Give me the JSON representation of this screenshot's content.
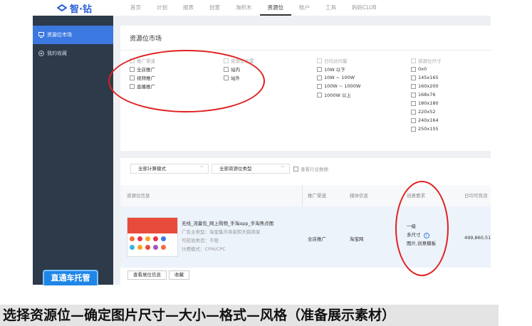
{
  "logo": {
    "text": "智·钻"
  },
  "nav": [
    "首页",
    "计划",
    "报表",
    "创意",
    "淘积木",
    "资源位",
    "账户",
    "工具",
    "妈妈CLUB"
  ],
  "nav_active": "资源位",
  "sidebar": {
    "items": [
      {
        "label": "资源位市场",
        "icon": "monitor-icon"
      },
      {
        "label": "我的收藏",
        "icon": "star-icon"
      }
    ],
    "banner": "直通车托管"
  },
  "market": {
    "title": "资源位市场",
    "col_channel": {
      "header": "推广渠道",
      "items": [
        "全店推广",
        "视频推广",
        "直播推广"
      ]
    },
    "col_position": {
      "header": "资源位位置",
      "items": [
        "站内",
        "站外"
      ]
    },
    "col_visits": {
      "header": "日均访问量",
      "items": [
        "10W 以下",
        "10W ~ 100W",
        "100W ~ 1000W",
        "1000W 以上"
      ]
    },
    "col_size": {
      "header": "资源位尺寸",
      "items": [
        "0x0",
        "145x165",
        "160x200",
        "168x76",
        "180x180",
        "220x52",
        "240x164",
        "250x155"
      ]
    }
  },
  "filters": {
    "mode": "全部计算模式",
    "type": "全部资源位类型",
    "industry": "查看行业数据"
  },
  "table": {
    "headers": [
      "资源位信息",
      "推广渠道",
      "媒体信息",
      "创意要求",
      "日均可竞流"
    ],
    "row": {
      "title": "无线_流量包_网上购物_手淘app_手淘焦点图",
      "meta": [
        "广告主类型：淘宝集市商家和天猫商家",
        "可投放类目：不限",
        "计费模式：CPM/CPC"
      ],
      "channel": "全店推广",
      "media": "淘宝网",
      "req": [
        "一级",
        "多尺寸",
        "图片,创意模板"
      ],
      "traffic": "499,860,51"
    },
    "actions": [
      "查看展位信息",
      "收藏"
    ]
  },
  "caption": "选择资源位—确定图片尺寸—大小—格式—风格（准备展示素材）",
  "colors": {
    "accent": "#3b79e0",
    "sidebar": "#2c3a4a",
    "annotation": "#e02020"
  }
}
